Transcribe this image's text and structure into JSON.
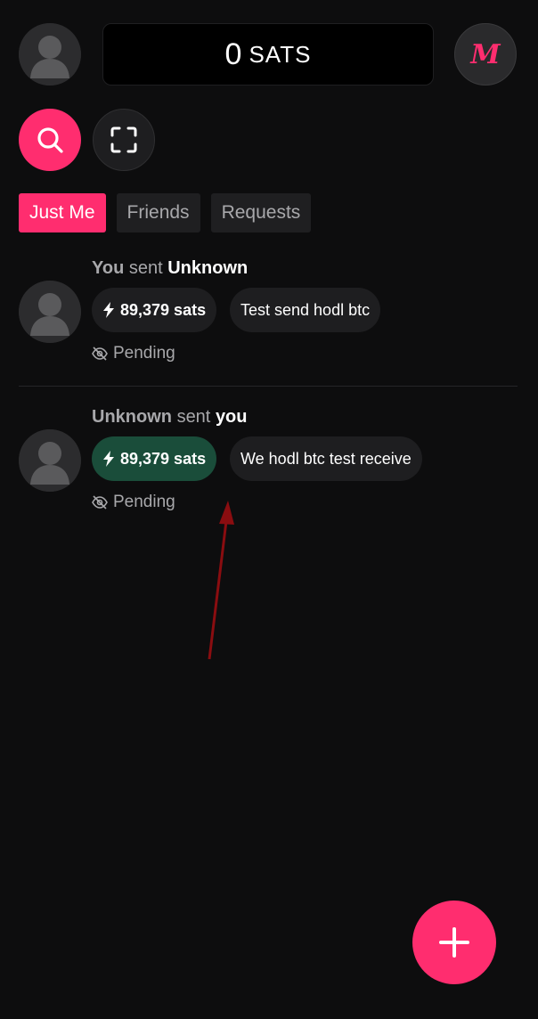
{
  "header": {
    "balance_amount": "0",
    "balance_unit": "SATS",
    "brand_mark": "M"
  },
  "actions": {
    "search_icon": "search-icon",
    "scan_icon": "scan-icon"
  },
  "tabs": [
    {
      "label": "Just Me",
      "active": true
    },
    {
      "label": "Friends",
      "active": false
    },
    {
      "label": "Requests",
      "active": false
    }
  ],
  "transactions": [
    {
      "from": "You",
      "verb": "sent",
      "to": "Unknown",
      "amount": "89,379 sats",
      "direction": "sent",
      "memo": "Test send hodl btc",
      "status": "Pending"
    },
    {
      "from": "Unknown",
      "verb": "sent",
      "to": "you",
      "amount": "89,379 sats",
      "direction": "received",
      "memo": "We hodl btc test receive",
      "status": "Pending"
    }
  ],
  "colors": {
    "accent": "#ff2d6f",
    "received": "#1a4d3a",
    "background": "#0d0d0e"
  }
}
